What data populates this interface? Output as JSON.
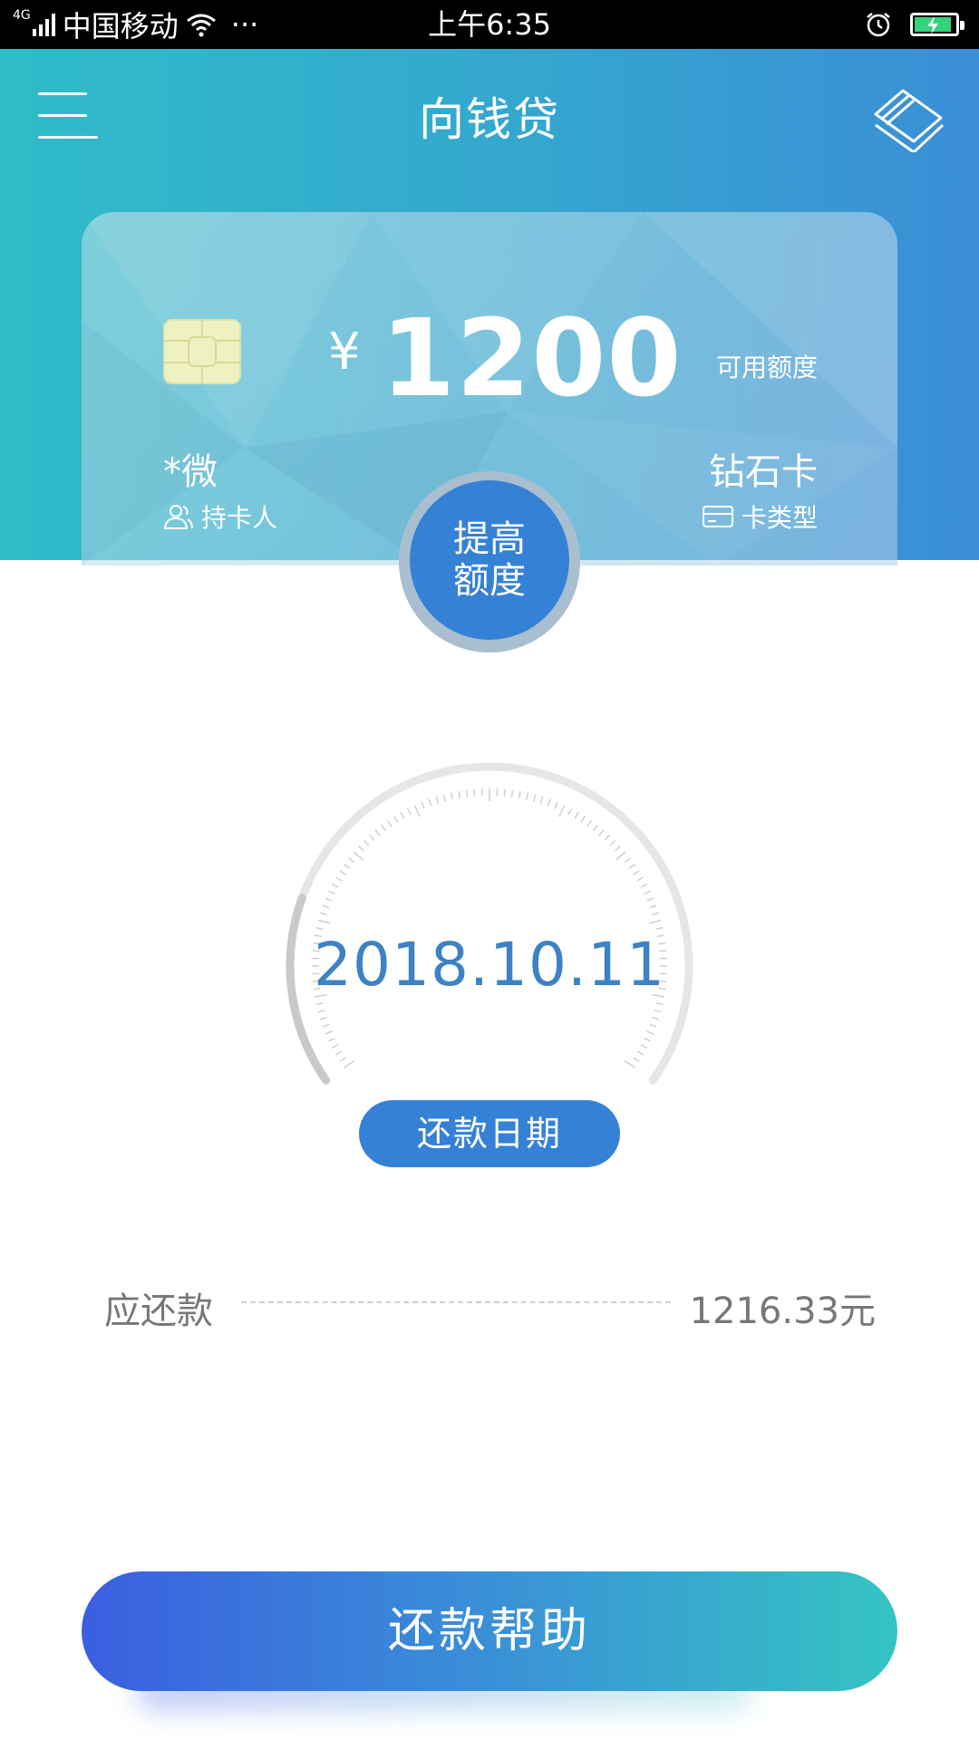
{
  "status_bar": {
    "network": "4G",
    "carrier": "中国移动",
    "more": "···",
    "time": "上午6:35"
  },
  "header": {
    "title": "向钱贷"
  },
  "card": {
    "currency": "¥",
    "amount": "1200",
    "available_label": "可用额度",
    "holder_name": "*微",
    "holder_label": "持卡人",
    "card_type": "钻石卡",
    "card_type_label": "卡类型"
  },
  "raise_credit": {
    "line1": "提高",
    "line2": "额度"
  },
  "repayment": {
    "date": "2018.10.11",
    "date_label": "还款日期",
    "amount_due_label": "应还款",
    "amount_due": "1216.33元"
  },
  "help_button": {
    "label": "还款帮助"
  },
  "colors": {
    "brand_blue": "#3581d6",
    "date_blue": "#3d82c4",
    "header_start": "#30bcc8",
    "header_end": "#3b8ed6",
    "battery_green": "#34d27a"
  },
  "icons": {
    "menu": "menu-icon",
    "cards": "cards-icon",
    "chip": "chip-icon",
    "holder": "person-icon",
    "card_type": "credit-card-icon"
  }
}
